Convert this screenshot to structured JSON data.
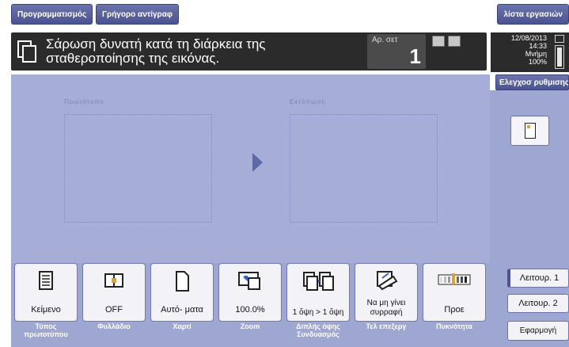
{
  "header": {
    "tab_programs": "Προγραμματισμός",
    "tab_quick_copy": "Γρήγορο αντίγραφ",
    "tab_job_list": "λίστα εργασιών"
  },
  "message_bar": {
    "line1": "Σάρωση δυνατή κατά τη διάρκεια της",
    "line2": "σταθεροποίησης της εικόνας.",
    "sets_label": "Αρ. σετ",
    "sets_value": "1"
  },
  "status": {
    "date": "12/08/2013",
    "time": "14:33",
    "memory_label": "Μνήμη",
    "memory_value": "100%",
    "memory_fraction": 1.0
  },
  "check_settings_label": "Ελεγχοσ ρυθμισης",
  "preview": {
    "original_label": "Πρωτότυπο",
    "output_label": "Εκτύπωση"
  },
  "function_buttons": [
    {
      "value": "Κείμενο",
      "label": "Τύπος πρωτοτύπου",
      "icon": "document-text-icon"
    },
    {
      "value": "OFF",
      "label": "Φυλλάδιο",
      "icon": "booklet-icon"
    },
    {
      "value": "Αυτό- ματα",
      "label": "Χαρτί",
      "icon": "paper-icon"
    },
    {
      "value": "100.0%",
      "label": "Zoom",
      "icon": "zoom-icon"
    },
    {
      "value": "1 ὄψη > 1 ὄψη",
      "label": "Διπλής όψης Συνδυασμός",
      "icon": "duplex-icon"
    },
    {
      "value": "Να μη γίνει συρραφή",
      "label": "Τελ επεξεργ",
      "icon": "finishing-icon"
    },
    {
      "value": "Προε",
      "label": "Πυκνότητα",
      "icon": "density-icon"
    }
  ],
  "mode_buttons": {
    "mode1": "Λειτουρ. 1",
    "mode2": "Λειτουρ. 2",
    "apply": "Εφαρμογή"
  },
  "colors": {
    "tab_blue": "#4a5391",
    "panel_blue": "#a6aed8",
    "message_bar": "#2b2b2b"
  }
}
